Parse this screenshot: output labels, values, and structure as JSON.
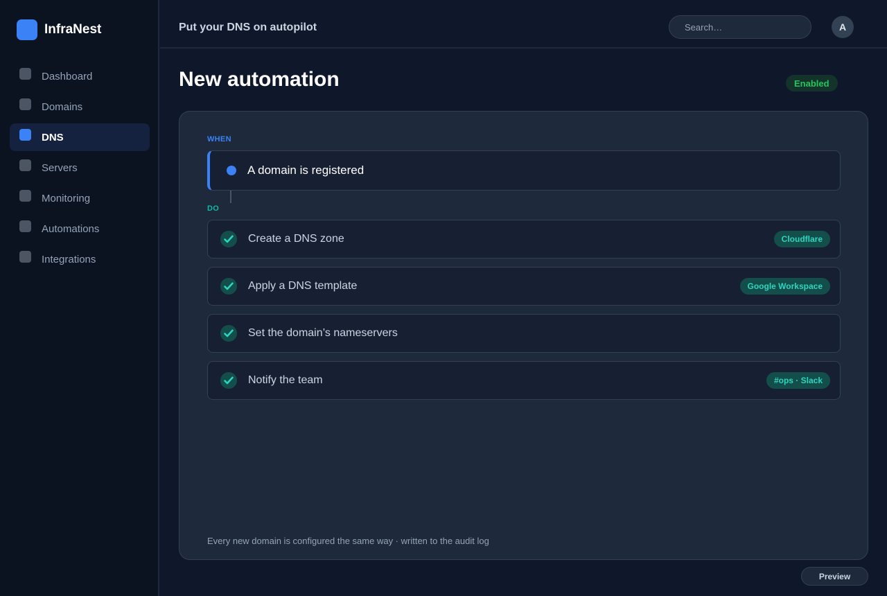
{
  "app": {
    "name": "InfraNest"
  },
  "sidebar": {
    "items": [
      {
        "label": "Dashboard",
        "active": false
      },
      {
        "label": "Domains",
        "active": false
      },
      {
        "label": "DNS",
        "active": true
      },
      {
        "label": "Servers",
        "active": false
      },
      {
        "label": "Monitoring",
        "active": false
      },
      {
        "label": "Automations",
        "active": false
      },
      {
        "label": "Integrations",
        "active": false
      }
    ]
  },
  "topbar": {
    "tagline": "Put your DNS on autopilot",
    "search_placeholder": "Search…",
    "avatar_initial": "A"
  },
  "page": {
    "title": "New automation",
    "status": "Enabled"
  },
  "automation": {
    "when_label": "WHEN",
    "trigger": "A domain is registered",
    "do_label": "DO",
    "actions": [
      {
        "label": "Create a DNS zone",
        "tag": "Cloudflare"
      },
      {
        "label": "Apply a DNS template",
        "tag": "Google Workspace"
      },
      {
        "label": "Set the domain’s nameservers",
        "tag": ""
      },
      {
        "label": "Notify the team",
        "tag": "#ops · Slack"
      }
    ],
    "footer_note": "Every new domain is configured the same way · written to the audit log"
  },
  "buttons": {
    "preview": "Preview"
  },
  "colors": {
    "accent": "#3b82f6",
    "success": "#22c55e",
    "teal": "#14b8a6"
  }
}
